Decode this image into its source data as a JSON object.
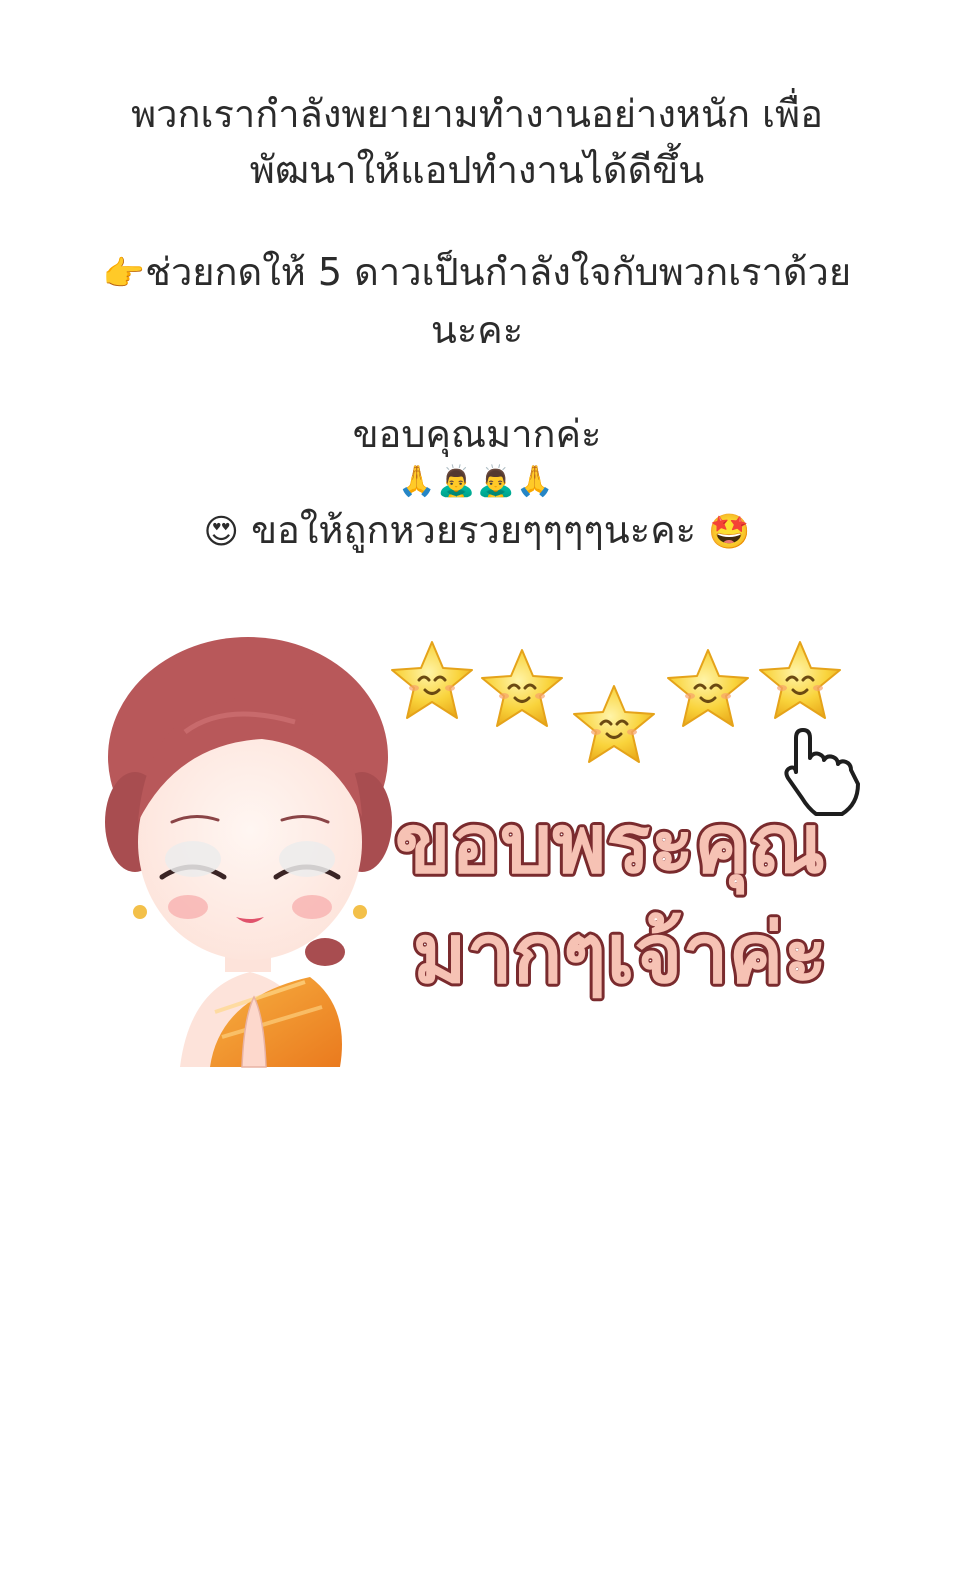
{
  "message": {
    "line1": "พวกเรากำลังพยายามทำงานอย่างหนัก เพื่อ",
    "line2": "พัฒนาให้แอปทำงานได้ดีขึ้น",
    "point_emoji": "👉",
    "line3": "ช่วยกดให้ 5 ดาวเป็นกำลังใจกับพวกเราด้วย",
    "line4": "นะคะ",
    "line5": "ขอบคุณมากค่ะ",
    "emoji_row": "🙏🙇‍♂️🙇‍♂️🙏",
    "heart_eyes_emoji": "😍",
    "line6": "ขอให้ถูกหวยรวยๆๆๆๆนะคะ",
    "star_eyes_emoji": "🤩"
  },
  "sticker": {
    "text_line1": "ขอบพระคุณ",
    "text_line2": "มากๆเจ้าค่ะ",
    "star_count": 5,
    "colors": {
      "text_fill": "#f6c2b4",
      "text_stroke": "#7a2b2e",
      "star": "#f9d33b",
      "hair": "#b8585a",
      "dress": "#f2922c"
    }
  }
}
